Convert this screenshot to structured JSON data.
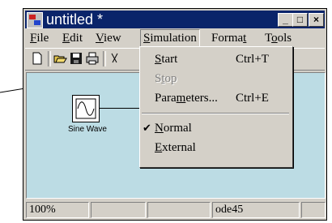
{
  "window": {
    "title": "untitled *",
    "controls": {
      "minimize": "_",
      "maximize": "□",
      "close": "×"
    }
  },
  "menubar": {
    "items": [
      "File",
      "Edit",
      "View",
      "Simulation",
      "Format",
      "Tools"
    ],
    "active": "Simulation"
  },
  "toolbar": {
    "icons": [
      "new-icon",
      "open-icon",
      "save-icon",
      "print-icon",
      "cut-icon"
    ]
  },
  "simulation_menu": {
    "items": [
      {
        "label": "Start",
        "shortcut": "Ctrl+T",
        "enabled": true,
        "checked": false
      },
      {
        "label": "Stop",
        "shortcut": "",
        "enabled": false,
        "checked": false
      },
      {
        "label": "Parameters...",
        "shortcut": "Ctrl+E",
        "enabled": true,
        "checked": false
      },
      {
        "label": "Normal",
        "shortcut": "",
        "enabled": true,
        "checked": true
      },
      {
        "label": "External",
        "shortcut": "",
        "enabled": true,
        "checked": false
      }
    ],
    "check_mark": "✔"
  },
  "canvas": {
    "block_label": "Sine Wave",
    "background": "#bcdce4"
  },
  "status": {
    "zoom": "100%",
    "solver": "ode45"
  },
  "colors": {
    "titlebar": "#0a246a",
    "chrome": "#d4d0c8"
  }
}
